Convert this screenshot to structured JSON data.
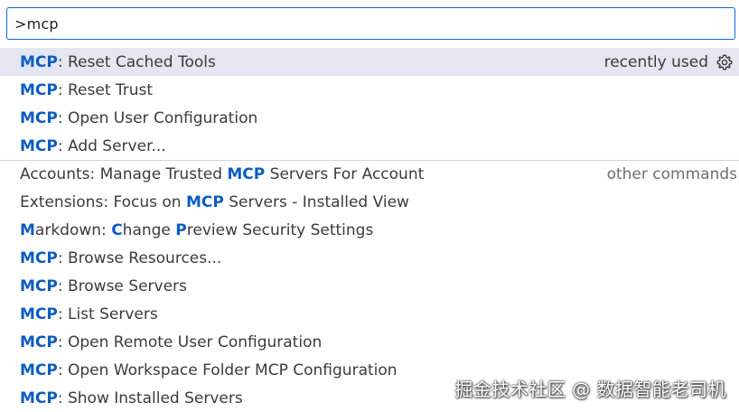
{
  "search": {
    "value": ">mcp"
  },
  "commands": [
    {
      "parts": [
        {
          "text": "MCP",
          "hl": true
        },
        {
          "text": ": Reset Cached Tools",
          "hl": false
        }
      ],
      "selected": true,
      "right_label": "recently used",
      "icon": "gear-icon"
    },
    {
      "parts": [
        {
          "text": "MCP",
          "hl": true
        },
        {
          "text": ": Reset Trust",
          "hl": false
        }
      ]
    },
    {
      "parts": [
        {
          "text": "MCP",
          "hl": true
        },
        {
          "text": ": Open User Configuration",
          "hl": false
        }
      ]
    },
    {
      "parts": [
        {
          "text": "MCP",
          "hl": true
        },
        {
          "text": ": Add Server...",
          "hl": false
        }
      ]
    },
    {
      "parts": [
        {
          "text": "Accounts: Manage Trusted ",
          "hl": false
        },
        {
          "text": "MCP",
          "hl": true
        },
        {
          "text": " Servers For Account",
          "hl": false
        }
      ],
      "group_start": true,
      "right_label": "other commands"
    },
    {
      "parts": [
        {
          "text": "Extensions: Focus on ",
          "hl": false
        },
        {
          "text": "MCP",
          "hl": true
        },
        {
          "text": " Servers - Installed View",
          "hl": false
        }
      ]
    },
    {
      "parts": [
        {
          "text": "M",
          "hl": true
        },
        {
          "text": "arkdown: ",
          "hl": false
        },
        {
          "text": "C",
          "hl": true
        },
        {
          "text": "hange ",
          "hl": false
        },
        {
          "text": "P",
          "hl": true
        },
        {
          "text": "review Security Settings",
          "hl": false
        }
      ]
    },
    {
      "parts": [
        {
          "text": "MCP",
          "hl": true
        },
        {
          "text": ": Browse Resources...",
          "hl": false
        }
      ]
    },
    {
      "parts": [
        {
          "text": "MCP",
          "hl": true
        },
        {
          "text": ": Browse Servers",
          "hl": false
        }
      ]
    },
    {
      "parts": [
        {
          "text": "MCP",
          "hl": true
        },
        {
          "text": ": List Servers",
          "hl": false
        }
      ]
    },
    {
      "parts": [
        {
          "text": "MCP",
          "hl": true
        },
        {
          "text": ": Open Remote User Configuration",
          "hl": false
        }
      ]
    },
    {
      "parts": [
        {
          "text": "MCP",
          "hl": true
        },
        {
          "text": ": Open Workspace Folder MCP Configuration",
          "hl": false
        }
      ]
    },
    {
      "parts": [
        {
          "text": "MCP",
          "hl": true
        },
        {
          "text": ": Show Installed Servers",
          "hl": false
        }
      ]
    }
  ],
  "watermark": "掘金技术社区 @ 数据智能老司机",
  "colors": {
    "accent": "#0b5cc4",
    "focus_border": "#0a66d6",
    "selected_background": "#e4e6f1",
    "text": "#3b3b3b",
    "muted": "#6f6f6f"
  }
}
